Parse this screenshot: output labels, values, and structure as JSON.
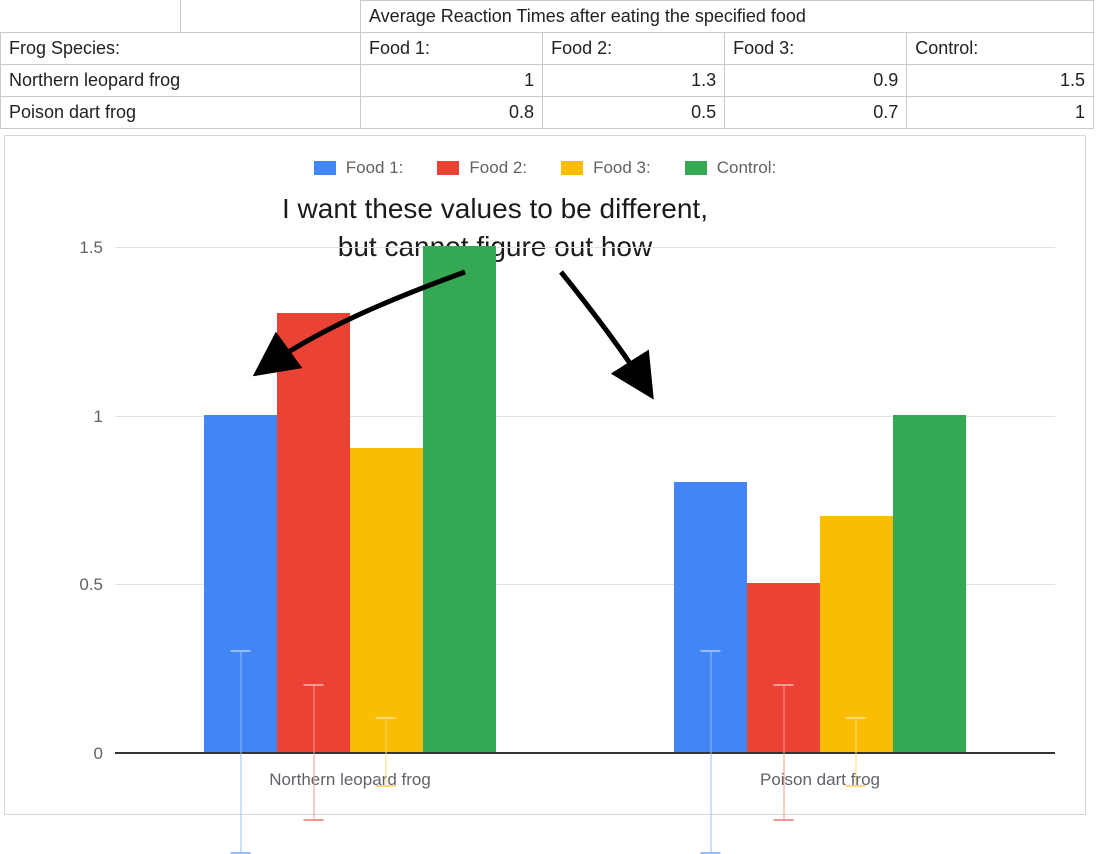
{
  "table": {
    "merged_header": "Average Reaction Times after eating the specified food",
    "header_row": [
      "Frog Species:",
      "Food 1:",
      "Food 2:",
      "Food 3:",
      "Control:"
    ],
    "rows": [
      {
        "species": "Northern leopard frog",
        "v": [
          "1",
          "1.3",
          "0.9",
          "1.5"
        ]
      },
      {
        "species": "Poison dart frog",
        "v": [
          "0.8",
          "0.5",
          "0.7",
          "1"
        ]
      }
    ]
  },
  "legend": {
    "items": [
      {
        "label": "Food 1:",
        "color": "#4285f4"
      },
      {
        "label": "Food 2:",
        "color": "#ea4335"
      },
      {
        "label": "Food 3:",
        "color": "#fbbc04"
      },
      {
        "label": "Control:",
        "color": "#34a853"
      }
    ]
  },
  "annotation": {
    "line1": "I want these values to be different,",
    "line2": "but cannot figure out how"
  },
  "y_ticks": [
    "0",
    "0.5",
    "1",
    "1.5"
  ],
  "x_categories": [
    "Northern leopard frog",
    "Poison dart frog"
  ],
  "chart_data": {
    "type": "bar",
    "title": "",
    "xlabel": "",
    "ylabel": "",
    "ylim": [
      0,
      1.6
    ],
    "y_ticks": [
      0,
      0.5,
      1,
      1.5
    ],
    "categories": [
      "Northern leopard frog",
      "Poison dart frog"
    ],
    "series": [
      {
        "name": "Food 1:",
        "color": "#4285f4",
        "values": [
          1.0,
          0.8
        ],
        "error": [
          0.3,
          0.3
        ]
      },
      {
        "name": "Food 2:",
        "color": "#ea4335",
        "values": [
          1.3,
          0.5
        ],
        "error": [
          0.2,
          0.2
        ]
      },
      {
        "name": "Food 3:",
        "color": "#fbbc04",
        "values": [
          0.9,
          0.7
        ],
        "error": [
          0.1,
          0.1
        ]
      },
      {
        "name": "Control:",
        "color": "#34a853",
        "values": [
          1.5,
          1.0
        ],
        "error": [
          0.0,
          0.0
        ]
      }
    ],
    "legend_position": "top",
    "grid": "horizontal",
    "annotation": "I want these values to be different, but cannot figure out how"
  }
}
